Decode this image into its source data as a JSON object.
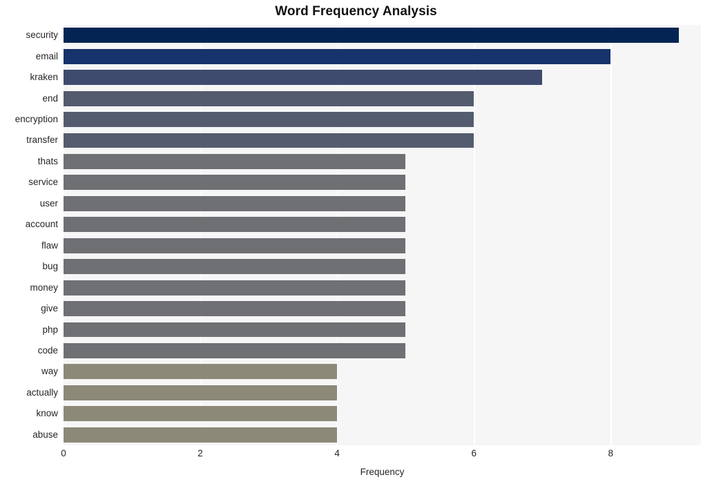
{
  "chart_data": {
    "type": "bar",
    "orientation": "horizontal",
    "title": "Word Frequency Analysis",
    "xlabel": "Frequency",
    "ylabel": "",
    "categories": [
      "security",
      "email",
      "kraken",
      "end",
      "encryption",
      "transfer",
      "thats",
      "service",
      "user",
      "account",
      "flaw",
      "bug",
      "money",
      "give",
      "php",
      "code",
      "way",
      "actually",
      "know",
      "abuse"
    ],
    "values": [
      9,
      8,
      7,
      6,
      6,
      6,
      5,
      5,
      5,
      5,
      5,
      5,
      5,
      5,
      5,
      5,
      4,
      4,
      4,
      4
    ],
    "bar_colors": [
      "#042553",
      "#17336b",
      "#3e4a6e",
      "#555b6e",
      "#555c6f",
      "#565c6f",
      "#6e7074",
      "#6e7074",
      "#6e7074",
      "#6e7074",
      "#6e7074",
      "#6e7074",
      "#6e7074",
      "#6e7074",
      "#6e7074",
      "#6e7074",
      "#8c8979",
      "#8c8979",
      "#8c8979",
      "#8c8979"
    ],
    "xlim": [
      0,
      9.32
    ],
    "xticks": [
      0,
      2,
      4,
      6,
      8
    ],
    "xtick_labels": [
      "0",
      "2",
      "4",
      "6",
      "8"
    ],
    "grid": true,
    "grid_axis": "x",
    "grid_color": "#ffffff",
    "plot_background": "#f6f6f7",
    "figure_background": "#ffffff",
    "legend": null
  }
}
